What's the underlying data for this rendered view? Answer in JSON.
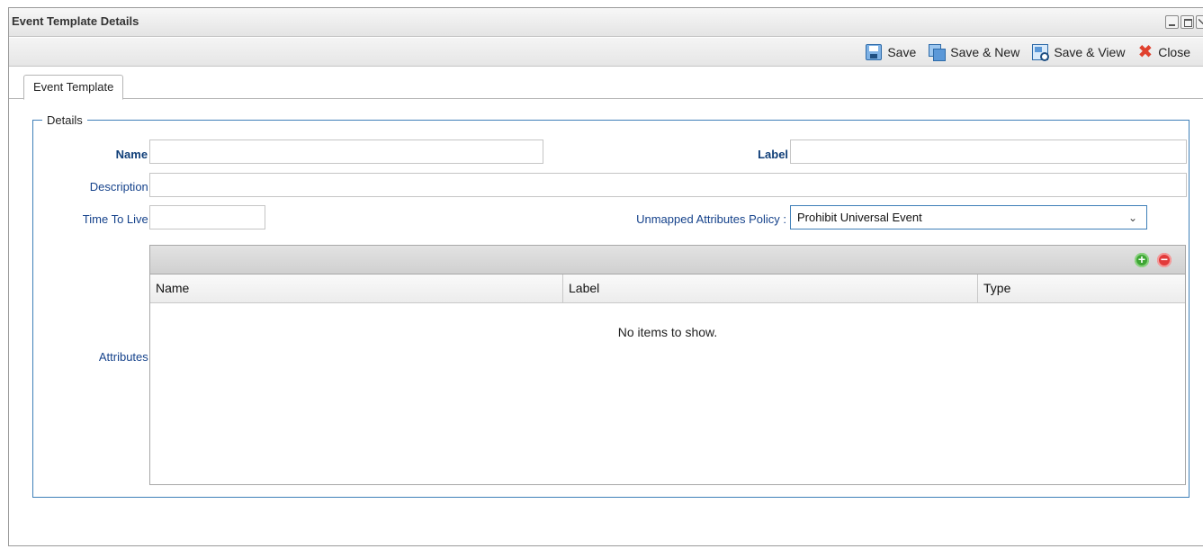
{
  "window": {
    "title": "Event Template Details"
  },
  "toolbar": {
    "save_label": "Save",
    "save_new_label": "Save & New",
    "save_view_label": "Save & View",
    "close_label": "Close"
  },
  "tabs": [
    {
      "label": "Event Template",
      "selected": true
    }
  ],
  "details": {
    "legend": "Details",
    "name_label": "Name :",
    "name_value": "",
    "label_label": "Label :",
    "label_value": "",
    "description_label": "Description :",
    "description_value": "",
    "ttl_label": "Time To Live :",
    "ttl_value": "",
    "policy_label": "Unmapped Attributes Policy :",
    "policy_value": "Prohibit Universal Event",
    "attributes_label": "Attributes :"
  },
  "attributes_grid": {
    "columns": [
      "Name",
      "Label",
      "Type"
    ],
    "rows": [],
    "empty_text": "No items to show."
  },
  "colors": {
    "label_text": "#15428b",
    "fieldset_border": "#3f7fb8",
    "add_button": "#3ea534",
    "remove_button": "#e23b3b",
    "close_icon": "#e0412e"
  }
}
